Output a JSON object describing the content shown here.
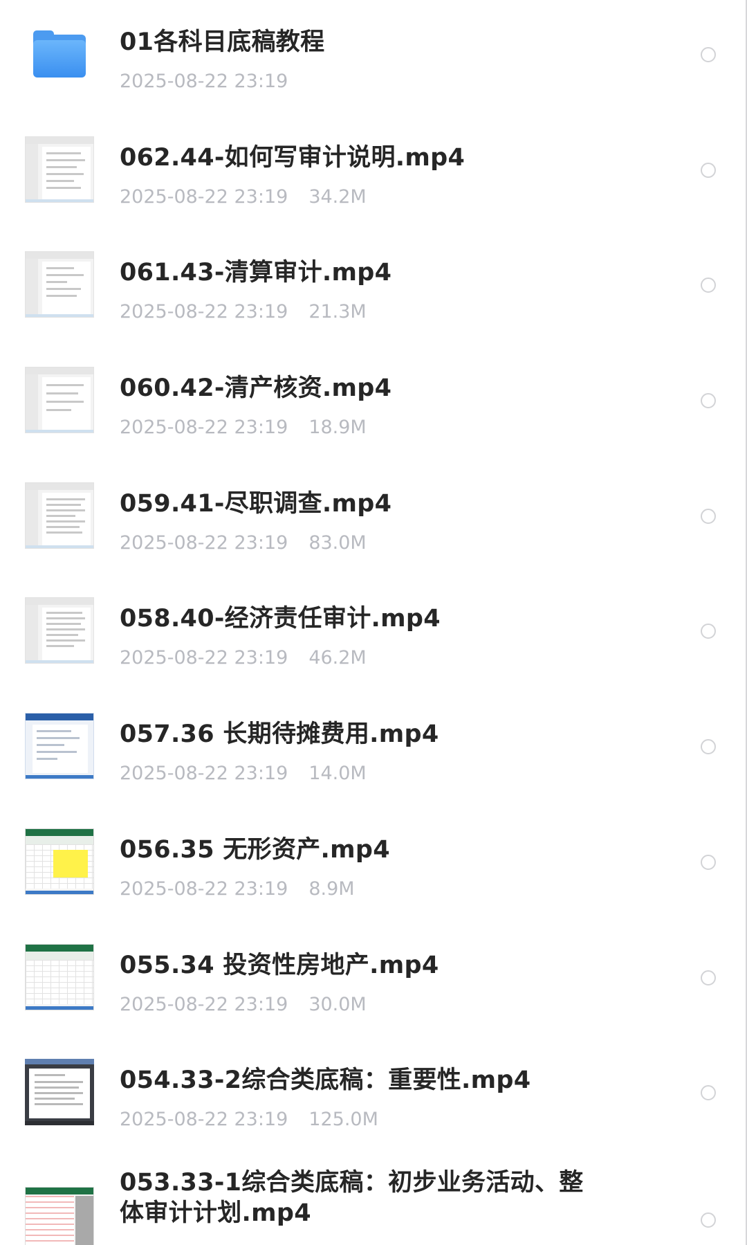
{
  "files": [
    {
      "name": "01各科目底稿教程",
      "date": "2025-08-22 23:19",
      "size": "",
      "type": "folder",
      "icon": "folder-icon"
    },
    {
      "name": "062.44-如何写审计说明.mp4",
      "date": "2025-08-22 23:19",
      "size": "34.2M",
      "type": "doc",
      "icon": "video-thumbnail"
    },
    {
      "name": "061.43-清算审计.mp4",
      "date": "2025-08-22 23:19",
      "size": "21.3M",
      "type": "doc",
      "icon": "video-thumbnail"
    },
    {
      "name": "060.42-清产核资.mp4",
      "date": "2025-08-22 23:19",
      "size": "18.9M",
      "type": "doc",
      "icon": "video-thumbnail"
    },
    {
      "name": "059.41-尽职调查.mp4",
      "date": "2025-08-22 23:19",
      "size": "83.0M",
      "type": "doc",
      "icon": "video-thumbnail"
    },
    {
      "name": "058.40-经济责任审计.mp4",
      "date": "2025-08-22 23:19",
      "size": "46.2M",
      "type": "doc",
      "icon": "video-thumbnail"
    },
    {
      "name": "057.36 长期待摊费用.mp4",
      "date": "2025-08-22 23:19",
      "size": "14.0M",
      "type": "blue",
      "icon": "video-thumbnail"
    },
    {
      "name": "056.35 无形资产.mp4",
      "date": "2025-08-22 23:19",
      "size": "8.9M",
      "type": "xls",
      "icon": "video-thumbnail"
    },
    {
      "name": "055.34 投资性房地产.mp4",
      "date": "2025-08-22 23:19",
      "size": "30.0M",
      "type": "xls-plain",
      "icon": "video-thumbnail"
    },
    {
      "name": "054.33-2综合类底稿：重要性.mp4",
      "date": "2025-08-22 23:19",
      "size": "125.0M",
      "type": "dark",
      "icon": "video-thumbnail"
    },
    {
      "name": "053.33-1综合类底稿：初步业务活动、整体审计计划.mp4",
      "date": "",
      "size": "",
      "type": "redxls",
      "icon": "video-thumbnail"
    }
  ],
  "colors": {
    "folder": "#4c9bf0",
    "title_text": "#262626",
    "meta_text": "#b8bac0",
    "radio_border": "#d2d3d6"
  }
}
